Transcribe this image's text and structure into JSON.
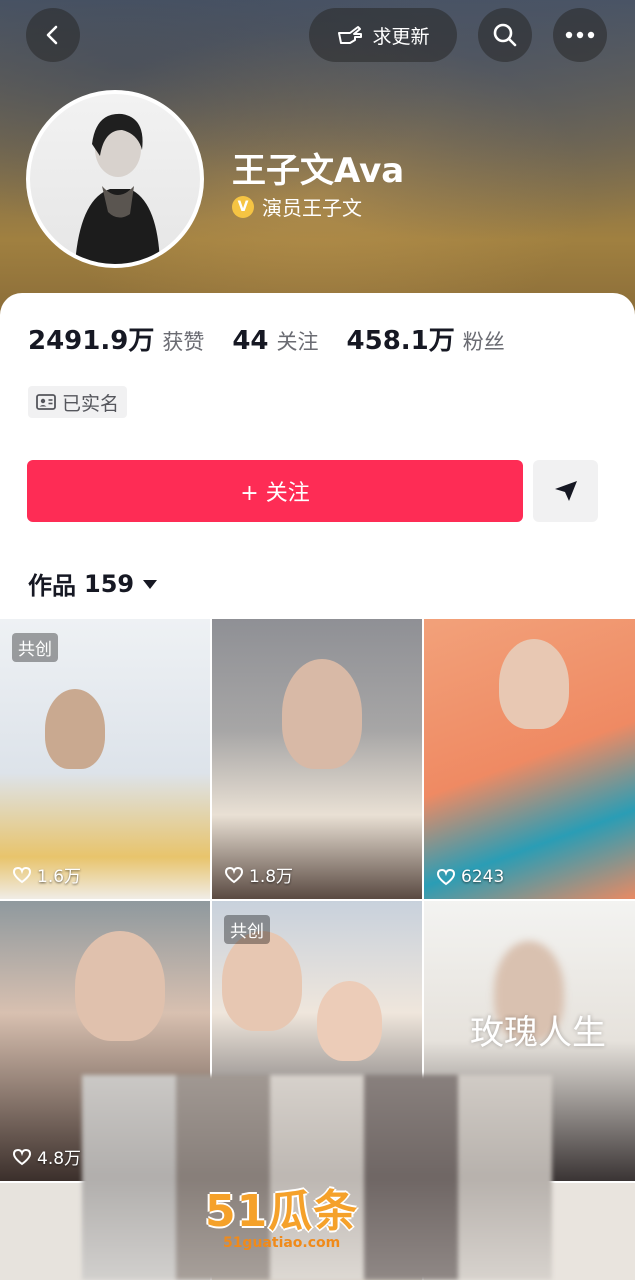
{
  "header": {
    "update_label": "求更新"
  },
  "profile": {
    "name": "王子文Ava",
    "verified_label": "演员王子文",
    "verified_badge": "V"
  },
  "stats": [
    {
      "value": "2491.9万",
      "label": "获赞"
    },
    {
      "value": "44",
      "label": "关注"
    },
    {
      "value": "458.1万",
      "label": "粉丝"
    }
  ],
  "realname_label": "已实名",
  "follow_label": "+ 关注",
  "works_tab": {
    "label": "作品",
    "count": "159"
  },
  "videos": [
    {
      "likes": "1.6万",
      "cocreate": "共创"
    },
    {
      "likes": "1.8万",
      "cocreate": ""
    },
    {
      "likes": "6243",
      "cocreate": ""
    },
    {
      "likes": "4.8万",
      "cocreate": ""
    },
    {
      "likes": "",
      "cocreate": "共创"
    },
    {
      "likes": "",
      "cocreate": "",
      "title": "玫瑰人生"
    }
  ],
  "watermark": {
    "brand": "51瓜条",
    "site": "51guatiao.com"
  },
  "colors": {
    "accent": "#fe2c55",
    "verify_badge": "#f5c443"
  }
}
